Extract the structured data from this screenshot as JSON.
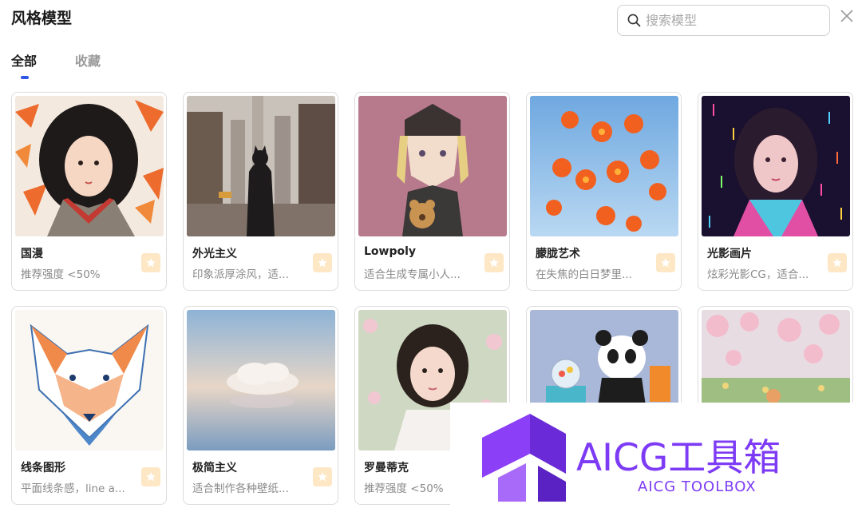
{
  "header": {
    "title": "风格模型",
    "search_placeholder": "搜索模型"
  },
  "tabs": [
    {
      "label": "全部",
      "active": true
    },
    {
      "label": "收藏",
      "active": false
    }
  ],
  "cards": [
    {
      "name": "国漫",
      "desc": "推荐强度 <50%"
    },
    {
      "name": "外光主义",
      "desc": "印象派厚涂风，适..."
    },
    {
      "name": "Lowpoly",
      "desc": "适合生成专属小人..."
    },
    {
      "name": "朦胧艺术",
      "desc": "在失焦的白日梦里..."
    },
    {
      "name": "光影画片",
      "desc": "炫彩光影CG，适合..."
    },
    {
      "name": "线条图形",
      "desc": "平面线条感，line a..."
    },
    {
      "name": "极简主义",
      "desc": "适合制作各种壁纸..."
    },
    {
      "name": "罗曼蒂克",
      "desc": "推荐强度 <50%"
    }
  ],
  "watermark": {
    "title": "AICG工具箱",
    "subtitle": "AICG TOOLBOX"
  },
  "icons": {
    "search": "search-icon",
    "close": "close-icon",
    "favorite": "star-icon"
  },
  "colors": {
    "accent": "#2f56e6",
    "favorite_bg": "#fde7c4",
    "brand": "#7d3bf5"
  }
}
